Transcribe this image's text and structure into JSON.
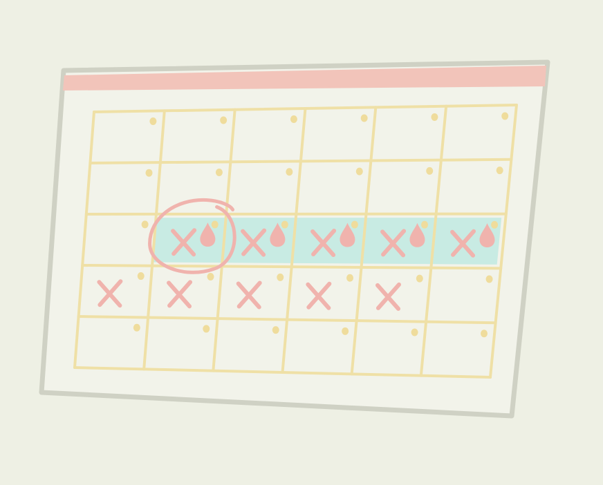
{
  "colors": {
    "background": "#eef0e4",
    "paper": "#f2f3ea",
    "paper_border": "#cfd1c4",
    "header_bar": "#f2c4ba",
    "grid_line": "#efe0a6",
    "day_dot": "#efdc9c",
    "highlight_band": "#c8ebe3",
    "mark": "#f0b3ad",
    "circle": "#f0b3ad"
  },
  "icons": {
    "cross_mark": "x-mark-icon",
    "drop_mark": "blood-drop-icon",
    "day_dot": "dot-icon",
    "circle": "circle-highlight"
  },
  "calendar": {
    "rows": 5,
    "cols": 6,
    "highlighted_row": 3,
    "highlighted_cols": [
      2,
      3,
      4,
      5,
      6
    ],
    "circled_cell": {
      "row": 3,
      "col": 2
    },
    "marks": [
      {
        "row": 3,
        "col": 2,
        "cross": true,
        "drop": true
      },
      {
        "row": 3,
        "col": 3,
        "cross": true,
        "drop": true
      },
      {
        "row": 3,
        "col": 4,
        "cross": true,
        "drop": true
      },
      {
        "row": 3,
        "col": 5,
        "cross": true,
        "drop": true
      },
      {
        "row": 3,
        "col": 6,
        "cross": true,
        "drop": true
      },
      {
        "row": 4,
        "col": 1,
        "cross": true,
        "drop": false
      },
      {
        "row": 4,
        "col": 2,
        "cross": true,
        "drop": false
      },
      {
        "row": 4,
        "col": 3,
        "cross": true,
        "drop": false
      },
      {
        "row": 4,
        "col": 4,
        "cross": true,
        "drop": false
      },
      {
        "row": 4,
        "col": 5,
        "cross": true,
        "drop": false
      }
    ]
  }
}
